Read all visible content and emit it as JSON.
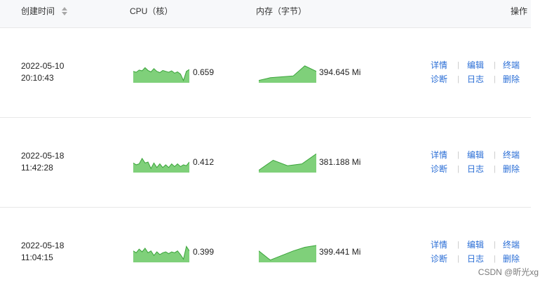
{
  "header": {
    "created": "创建时间",
    "cpu": "CPU（核）",
    "memory": "内存（字节）",
    "ops": "操作"
  },
  "colors": {
    "spark_fill": "#7fd07a",
    "spark_stroke": "#3aa43a",
    "link": "#2a6ed6"
  },
  "rows": [
    {
      "date": "2022-05-10",
      "time": "20:10:43",
      "cpu_value": "0.659",
      "mem_value": "394.645 Mi",
      "cpu_series": [
        0.55,
        0.5,
        0.62,
        0.58,
        0.75,
        0.6,
        0.52,
        0.7,
        0.55,
        0.48,
        0.6,
        0.55,
        0.5,
        0.58,
        0.45,
        0.52,
        0.4,
        0.05,
        0.55,
        0.65
      ],
      "mem_series": [
        0.05,
        0.2,
        0.25,
        0.3,
        0.85,
        0.55
      ]
    },
    {
      "date": "2022-05-18",
      "time": "11:42:28",
      "cpu_value": "0.412",
      "mem_value": "381.188 Mi",
      "cpu_series": [
        0.45,
        0.35,
        0.4,
        0.7,
        0.45,
        0.5,
        0.15,
        0.45,
        0.2,
        0.4,
        0.2,
        0.35,
        0.2,
        0.4,
        0.25,
        0.4,
        0.25,
        0.35,
        0.3,
        0.5
      ],
      "mem_series": [
        0.05,
        0.6,
        0.3,
        0.4,
        0.95
      ]
    },
    {
      "date": "2022-05-18",
      "time": "11:04:15",
      "cpu_value": "0.399",
      "mem_value": "399.441 Mi",
      "cpu_series": [
        0.55,
        0.45,
        0.65,
        0.5,
        0.7,
        0.45,
        0.55,
        0.3,
        0.5,
        0.35,
        0.45,
        0.5,
        0.4,
        0.5,
        0.45,
        0.55,
        0.35,
        0.1,
        0.8,
        0.55
      ],
      "mem_series": [
        0.55,
        0.05,
        0.3,
        0.55,
        0.75,
        0.85
      ]
    }
  ],
  "ops": {
    "detail": "详情",
    "edit": "编辑",
    "terminal": "终端",
    "diagnose": "诊断",
    "log": "日志",
    "delete": "删除",
    "sep": "|"
  },
  "watermark": "CSDN @昕光xg"
}
